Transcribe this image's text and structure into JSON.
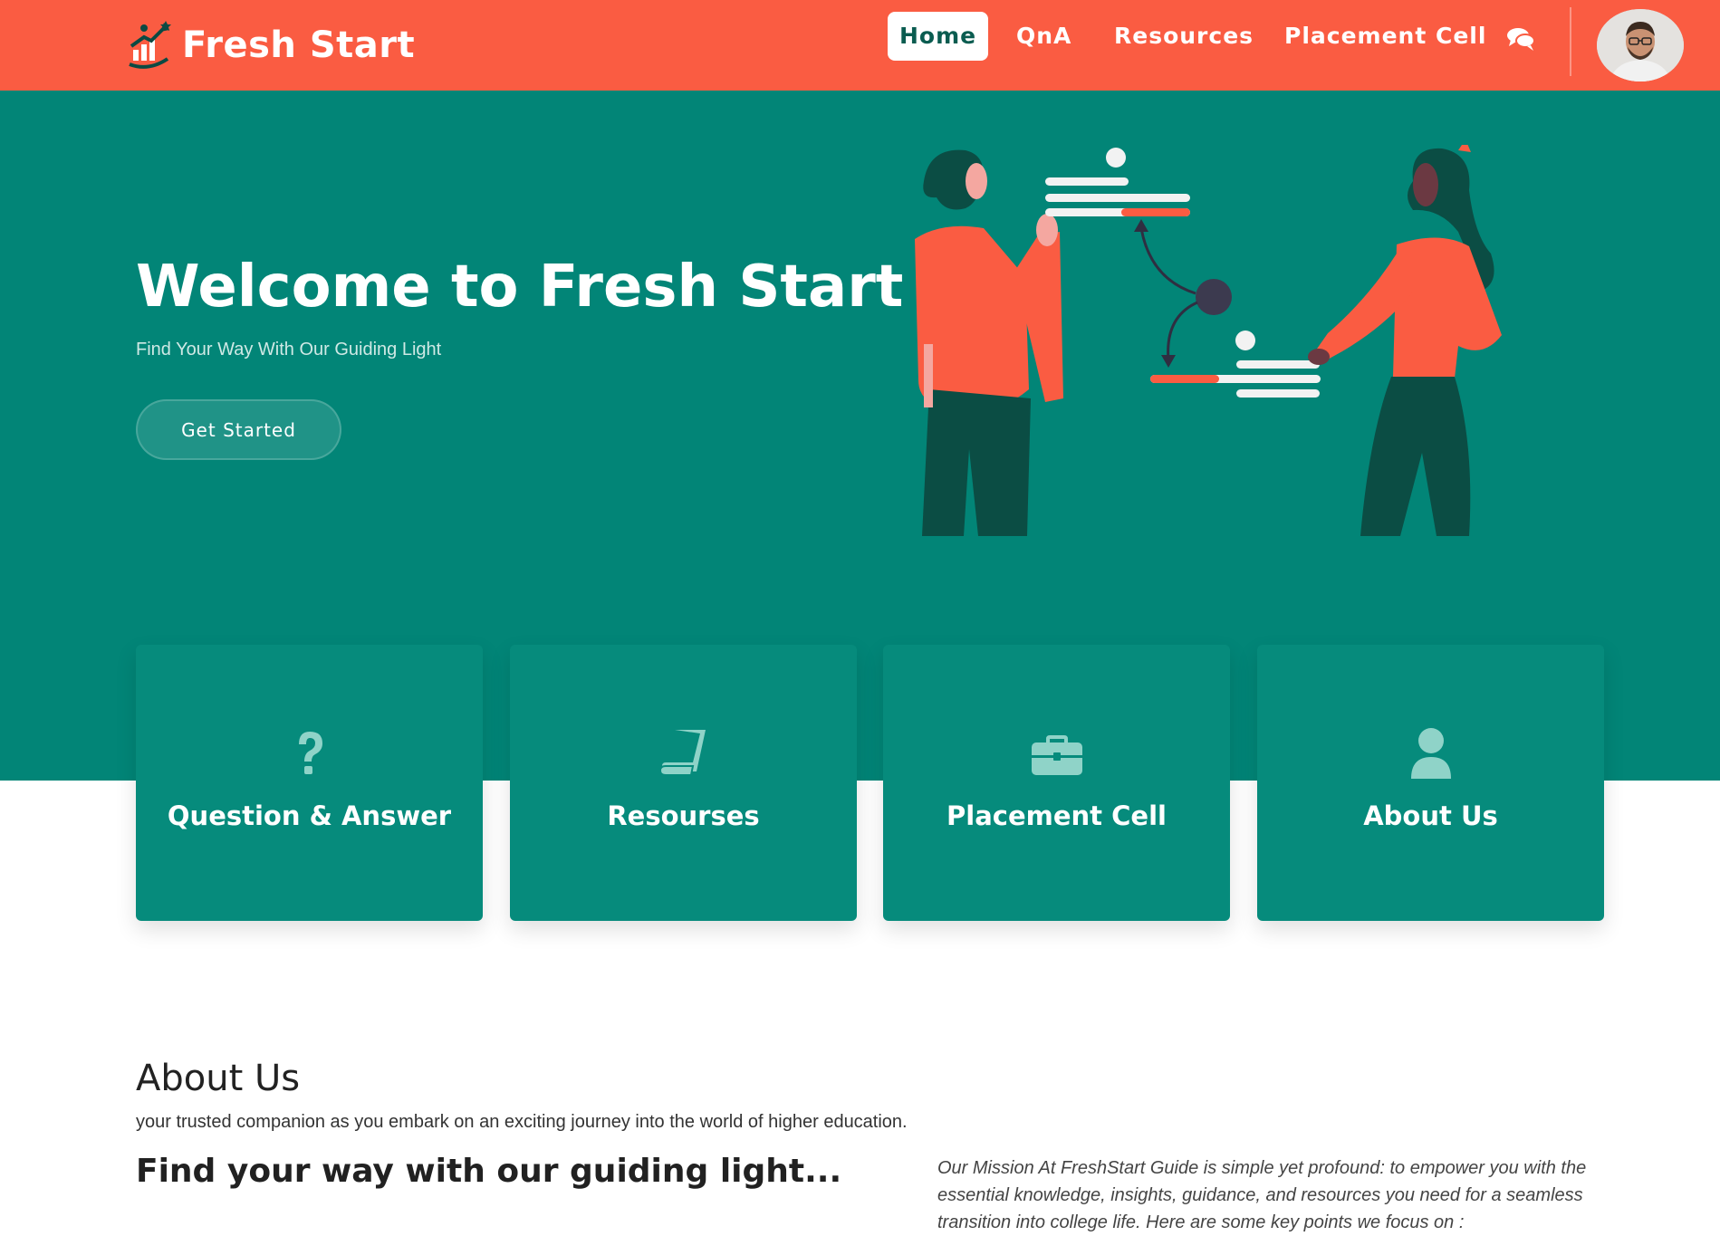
{
  "brand": {
    "name": "Fresh Start",
    "logo_icon": "growth-chart-icon"
  },
  "nav": {
    "items": [
      {
        "label": "Home",
        "active": true
      },
      {
        "label": "QnA",
        "active": false
      },
      {
        "label": "Resources",
        "active": false
      },
      {
        "label": "Placement Cell",
        "active": false
      }
    ],
    "chat_icon": "chat-bubbles-icon",
    "avatar_icon": "user-avatar"
  },
  "hero": {
    "title": "Welcome to Fresh Start",
    "subtitle": "Find Your Way With Our Guiding Light",
    "cta_label": "Get Started"
  },
  "services": [
    {
      "title": "Question & Answer",
      "icon": "question-mark-icon"
    },
    {
      "title": "Resourses",
      "icon": "book-icon"
    },
    {
      "title": "Placement Cell",
      "icon": "briefcase-icon"
    },
    {
      "title": "About Us",
      "icon": "user-icon"
    }
  ],
  "about": {
    "heading": "About Us",
    "intro": "your trusted companion as you embark on an exciting journey into the world of higher education.",
    "tagline": "Find your way with our guiding light...",
    "mission": "Our Mission At FreshStart Guide is simple yet profound: to empower you with the essential knowledge, insights, guidance, and resources you need for a seamless transition into college life. Here are some key points we focus on :"
  },
  "colors": {
    "header": "#fa5c42",
    "hero": "#028577",
    "card": "#068b7c",
    "nav_active_text": "#0a5c50"
  }
}
